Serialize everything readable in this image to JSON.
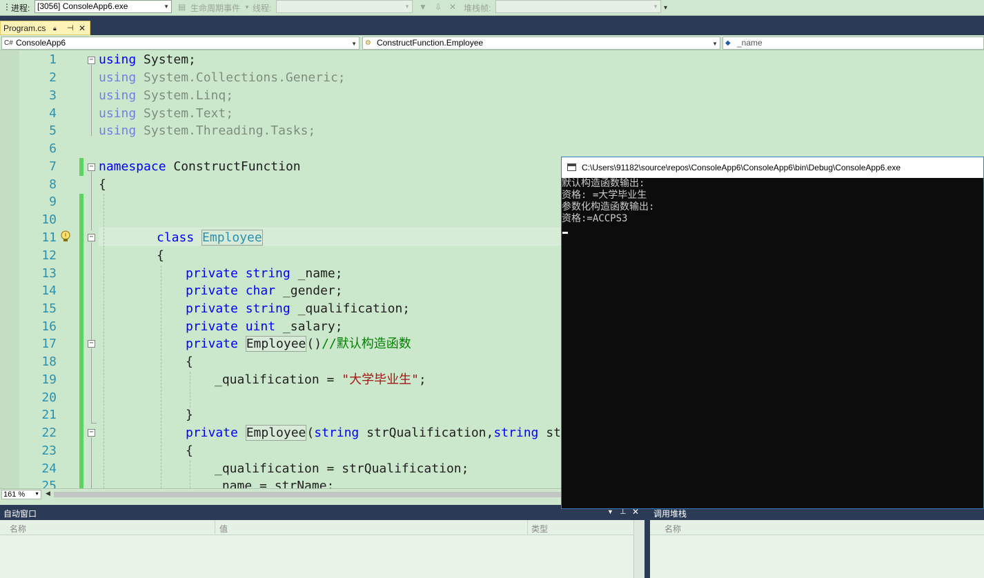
{
  "toolbar": {
    "process_label": "进程:",
    "process_value": "[3056] ConsoleApp6.exe",
    "lifecycle_label": "生命周期事件",
    "thread_label": "线程:",
    "stackframe_label": "堆栈帧:"
  },
  "tab": {
    "title": "Program.cs"
  },
  "navbar": {
    "project": "ConsoleApp6",
    "type": "ConstructFunction.Employee",
    "member": "_name"
  },
  "editor": {
    "line_numbers": [
      "1",
      "2",
      "3",
      "4",
      "5",
      "6",
      "7",
      "8",
      "9",
      "10",
      "11",
      "12",
      "13",
      "14",
      "15",
      "16",
      "17",
      "18",
      "19",
      "20",
      "21",
      "22",
      "23",
      "24",
      "25"
    ],
    "lines": {
      "l1": [
        "using",
        " System;"
      ],
      "l2": [
        "using",
        " System.Collections.Generic;"
      ],
      "l3": [
        "using",
        " System.Linq;"
      ],
      "l4": [
        "using",
        " System.Text;"
      ],
      "l5": [
        "using",
        " System.Threading.Tasks;"
      ],
      "l7": [
        "namespace",
        " ConstructFunction"
      ],
      "l8": "{",
      "l11": [
        "class",
        "Employee"
      ],
      "l12": "{",
      "l13": [
        "private",
        "string",
        " _name;"
      ],
      "l14": [
        "private",
        "char",
        " _gender;"
      ],
      "l15": [
        "private",
        "string",
        " _qualification;"
      ],
      "l16": [
        "private",
        "uint",
        " _salary;"
      ],
      "l17": [
        "private",
        "Employee",
        "()",
        "//默认构造函数"
      ],
      "l18": "{",
      "l19": [
        "_qualification = ",
        "\"大学毕业生\"",
        ";"
      ],
      "l21": "}",
      "l22": [
        "private",
        "Employee",
        "(",
        "string",
        " strQualification,",
        "string",
        " strN"
      ],
      "l23": "{",
      "l24": "_qualification = strQualification;",
      "l25": "_name = strName;"
    },
    "zoom": "161 %"
  },
  "console": {
    "title": "C:\\Users\\91182\\source\\repos\\ConsoleApp6\\ConsoleApp6\\bin\\Debug\\ConsoleApp6.exe",
    "output": [
      "默认构造函数输出:",
      "资格: =大学毕业生",
      "参数化构造函数输出:",
      "资格:=ACCPS3"
    ]
  },
  "autos": {
    "title": "自动窗口",
    "columns": [
      "名称",
      "值",
      "类型"
    ]
  },
  "callstack": {
    "title": "调用堆栈",
    "columns": [
      "名称"
    ]
  },
  "colors": {
    "editor_bg": "#cce8cc",
    "panel_title_bg": "#2b3a55",
    "keyword": "#0000ff",
    "type": "#2b91af",
    "comment": "#008000",
    "string": "#a31515",
    "change_bar": "#60d060"
  }
}
